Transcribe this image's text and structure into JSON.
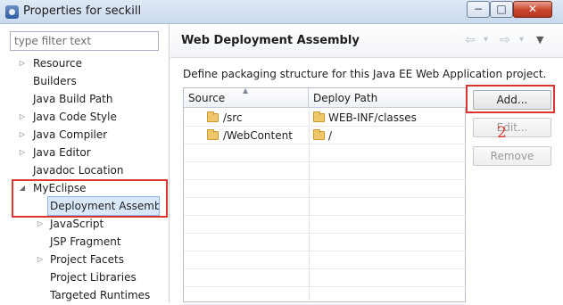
{
  "window": {
    "title": "Properties for seckill",
    "controls": {
      "minimize": "−",
      "maximize": "□",
      "close": "✕"
    }
  },
  "filter": {
    "placeholder": "type filter text"
  },
  "tree": {
    "items": [
      {
        "label": "Resource",
        "expander": "▷"
      },
      {
        "label": "Builders",
        "expander": ""
      },
      {
        "label": "Java Build Path",
        "expander": ""
      },
      {
        "label": "Java Code Style",
        "expander": "▷"
      },
      {
        "label": "Java Compiler",
        "expander": "▷"
      },
      {
        "label": "Java Editor",
        "expander": "▷"
      },
      {
        "label": "Javadoc Location",
        "expander": ""
      },
      {
        "label": "MyEclipse",
        "expander": "◢"
      },
      {
        "label": "Deployment Assembly",
        "expander": ""
      },
      {
        "label": "JavaScript",
        "expander": "▷"
      },
      {
        "label": "JSP Fragment",
        "expander": ""
      },
      {
        "label": "Project Facets",
        "expander": "▷"
      },
      {
        "label": "Project Libraries",
        "expander": ""
      },
      {
        "label": "Targeted Runtimes",
        "expander": ""
      }
    ]
  },
  "page": {
    "title": "Web Deployment Assembly",
    "description": "Define packaging structure for this Java EE Web Application project.",
    "nav": {
      "back": "⇦",
      "back_menu": "▾",
      "forward": "⇨",
      "forward_menu": "▾",
      "view_menu": "▼"
    }
  },
  "table": {
    "columns": [
      "Source",
      "Deploy Path"
    ],
    "sort_indicator": "▲",
    "rows": [
      {
        "source": "/src",
        "deploy": "WEB-INF/classes"
      },
      {
        "source": "/WebContent",
        "deploy": "/"
      }
    ]
  },
  "buttons": {
    "add": "Add...",
    "edit": "Edit...",
    "remove": "Remove"
  },
  "annotations": {
    "one": "1",
    "two": "2",
    "color": "#d9362f"
  },
  "colors": {
    "selection": "#d9e8fb",
    "folder": "#efc66a"
  }
}
